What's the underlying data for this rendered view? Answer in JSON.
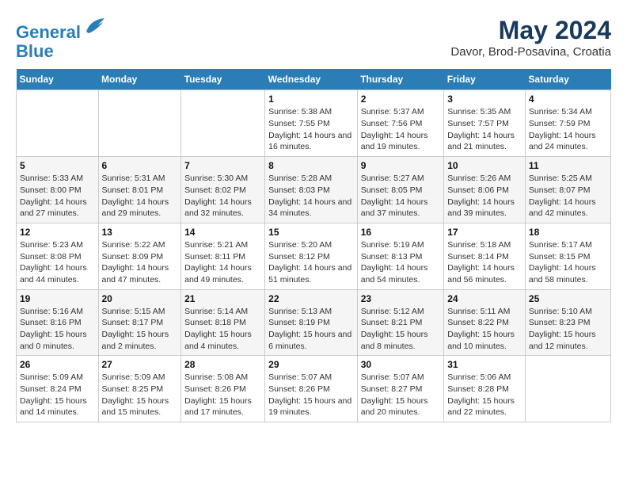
{
  "header": {
    "logo_line1": "General",
    "logo_line2": "Blue",
    "main_title": "May 2024",
    "subtitle": "Davor, Brod-Posavina, Croatia"
  },
  "weekdays": [
    "Sunday",
    "Monday",
    "Tuesday",
    "Wednesday",
    "Thursday",
    "Friday",
    "Saturday"
  ],
  "weeks": [
    [
      {
        "day": "",
        "info": ""
      },
      {
        "day": "",
        "info": ""
      },
      {
        "day": "",
        "info": ""
      },
      {
        "day": "1",
        "info": "Sunrise: 5:38 AM\nSunset: 7:55 PM\nDaylight: 14 hours and 16 minutes."
      },
      {
        "day": "2",
        "info": "Sunrise: 5:37 AM\nSunset: 7:56 PM\nDaylight: 14 hours and 19 minutes."
      },
      {
        "day": "3",
        "info": "Sunrise: 5:35 AM\nSunset: 7:57 PM\nDaylight: 14 hours and 21 minutes."
      },
      {
        "day": "4",
        "info": "Sunrise: 5:34 AM\nSunset: 7:59 PM\nDaylight: 14 hours and 24 minutes."
      }
    ],
    [
      {
        "day": "5",
        "info": "Sunrise: 5:33 AM\nSunset: 8:00 PM\nDaylight: 14 hours and 27 minutes."
      },
      {
        "day": "6",
        "info": "Sunrise: 5:31 AM\nSunset: 8:01 PM\nDaylight: 14 hours and 29 minutes."
      },
      {
        "day": "7",
        "info": "Sunrise: 5:30 AM\nSunset: 8:02 PM\nDaylight: 14 hours and 32 minutes."
      },
      {
        "day": "8",
        "info": "Sunrise: 5:28 AM\nSunset: 8:03 PM\nDaylight: 14 hours and 34 minutes."
      },
      {
        "day": "9",
        "info": "Sunrise: 5:27 AM\nSunset: 8:05 PM\nDaylight: 14 hours and 37 minutes."
      },
      {
        "day": "10",
        "info": "Sunrise: 5:26 AM\nSunset: 8:06 PM\nDaylight: 14 hours and 39 minutes."
      },
      {
        "day": "11",
        "info": "Sunrise: 5:25 AM\nSunset: 8:07 PM\nDaylight: 14 hours and 42 minutes."
      }
    ],
    [
      {
        "day": "12",
        "info": "Sunrise: 5:23 AM\nSunset: 8:08 PM\nDaylight: 14 hours and 44 minutes."
      },
      {
        "day": "13",
        "info": "Sunrise: 5:22 AM\nSunset: 8:09 PM\nDaylight: 14 hours and 47 minutes."
      },
      {
        "day": "14",
        "info": "Sunrise: 5:21 AM\nSunset: 8:11 PM\nDaylight: 14 hours and 49 minutes."
      },
      {
        "day": "15",
        "info": "Sunrise: 5:20 AM\nSunset: 8:12 PM\nDaylight: 14 hours and 51 minutes."
      },
      {
        "day": "16",
        "info": "Sunrise: 5:19 AM\nSunset: 8:13 PM\nDaylight: 14 hours and 54 minutes."
      },
      {
        "day": "17",
        "info": "Sunrise: 5:18 AM\nSunset: 8:14 PM\nDaylight: 14 hours and 56 minutes."
      },
      {
        "day": "18",
        "info": "Sunrise: 5:17 AM\nSunset: 8:15 PM\nDaylight: 14 hours and 58 minutes."
      }
    ],
    [
      {
        "day": "19",
        "info": "Sunrise: 5:16 AM\nSunset: 8:16 PM\nDaylight: 15 hours and 0 minutes."
      },
      {
        "day": "20",
        "info": "Sunrise: 5:15 AM\nSunset: 8:17 PM\nDaylight: 15 hours and 2 minutes."
      },
      {
        "day": "21",
        "info": "Sunrise: 5:14 AM\nSunset: 8:18 PM\nDaylight: 15 hours and 4 minutes."
      },
      {
        "day": "22",
        "info": "Sunrise: 5:13 AM\nSunset: 8:19 PM\nDaylight: 15 hours and 6 minutes."
      },
      {
        "day": "23",
        "info": "Sunrise: 5:12 AM\nSunset: 8:21 PM\nDaylight: 15 hours and 8 minutes."
      },
      {
        "day": "24",
        "info": "Sunrise: 5:11 AM\nSunset: 8:22 PM\nDaylight: 15 hours and 10 minutes."
      },
      {
        "day": "25",
        "info": "Sunrise: 5:10 AM\nSunset: 8:23 PM\nDaylight: 15 hours and 12 minutes."
      }
    ],
    [
      {
        "day": "26",
        "info": "Sunrise: 5:09 AM\nSunset: 8:24 PM\nDaylight: 15 hours and 14 minutes."
      },
      {
        "day": "27",
        "info": "Sunrise: 5:09 AM\nSunset: 8:25 PM\nDaylight: 15 hours and 15 minutes."
      },
      {
        "day": "28",
        "info": "Sunrise: 5:08 AM\nSunset: 8:26 PM\nDaylight: 15 hours and 17 minutes."
      },
      {
        "day": "29",
        "info": "Sunrise: 5:07 AM\nSunset: 8:26 PM\nDaylight: 15 hours and 19 minutes."
      },
      {
        "day": "30",
        "info": "Sunrise: 5:07 AM\nSunset: 8:27 PM\nDaylight: 15 hours and 20 minutes."
      },
      {
        "day": "31",
        "info": "Sunrise: 5:06 AM\nSunset: 8:28 PM\nDaylight: 15 hours and 22 minutes."
      },
      {
        "day": "",
        "info": ""
      }
    ]
  ]
}
